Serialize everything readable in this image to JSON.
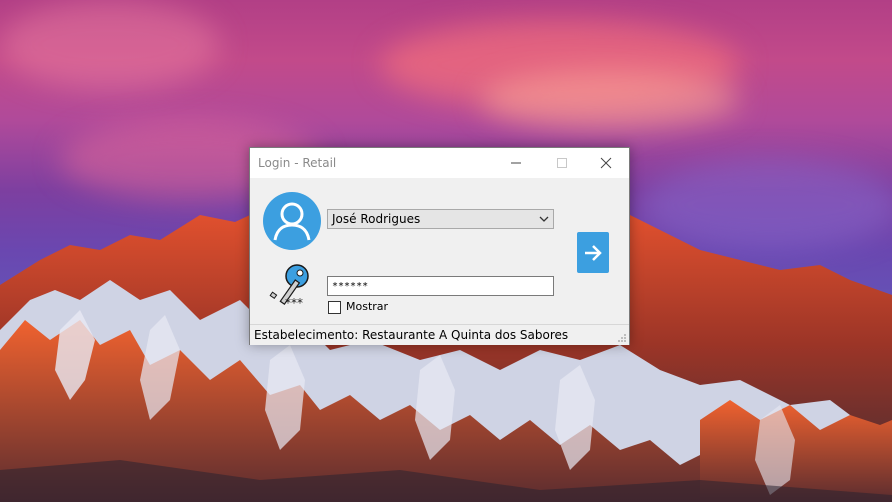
{
  "window": {
    "title": "Login - Retail"
  },
  "title_bar_buttons": {
    "minimize_icon": "minimize-icon",
    "maximize_icon": "maximize-icon",
    "close_icon": "close-icon"
  },
  "login": {
    "user_selected": "José Rodrigues",
    "password_masked": "******",
    "show_password_label": "Mostrar",
    "show_password_checked": false,
    "submit_icon": "arrow-right-icon"
  },
  "status_bar": {
    "text": "Estabelecimento: Restaurante A Quinta dos Sabores"
  },
  "colors": {
    "accent": "#3c9fe0",
    "window_bg": "#f0f0f0",
    "avatar": "#3c9fe0"
  }
}
